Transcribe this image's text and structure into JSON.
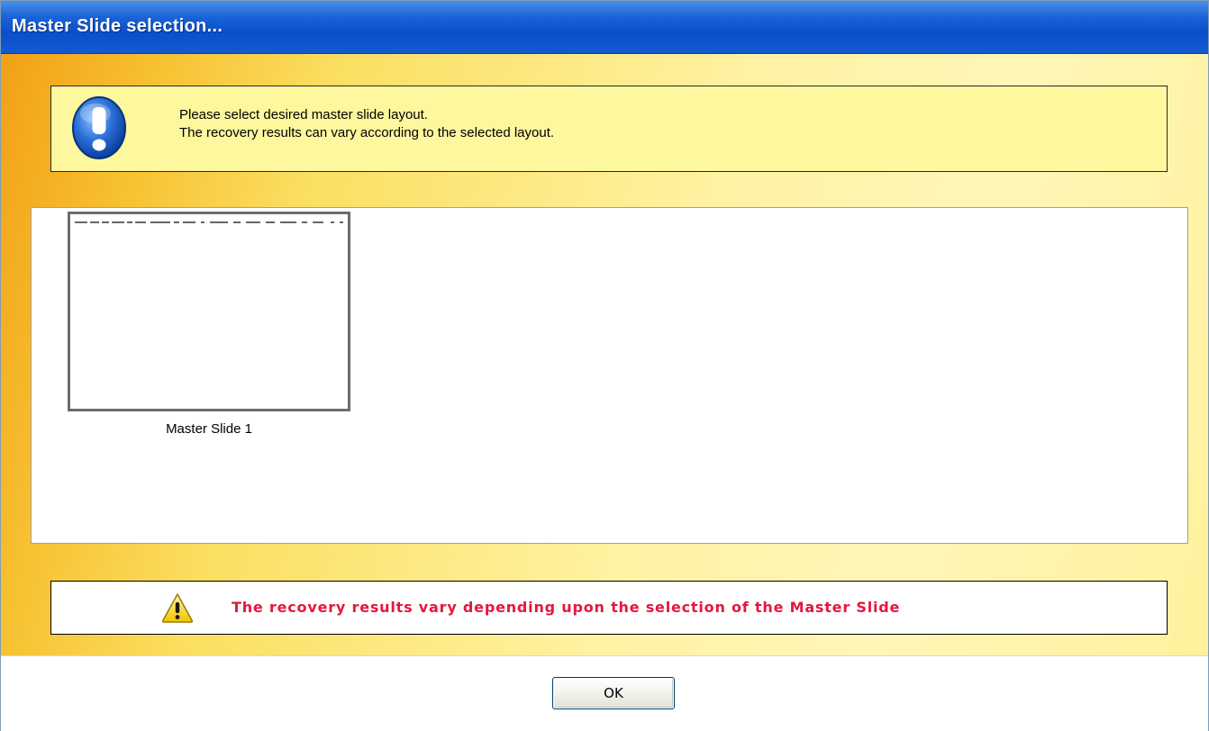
{
  "window": {
    "title": "Master Slide selection..."
  },
  "info": {
    "icon": "exclamation-info-icon",
    "line1": "Please select desired master slide layout.",
    "line2": "The recovery results can vary according to the selected layout."
  },
  "slides": [
    {
      "caption": "Master Slide 1"
    }
  ],
  "warning": {
    "icon": "warning-icon",
    "text": "The recovery results vary depending upon the selection of the Master Slide",
    "color": "#e4173e"
  },
  "footer": {
    "ok_label": "OK"
  }
}
